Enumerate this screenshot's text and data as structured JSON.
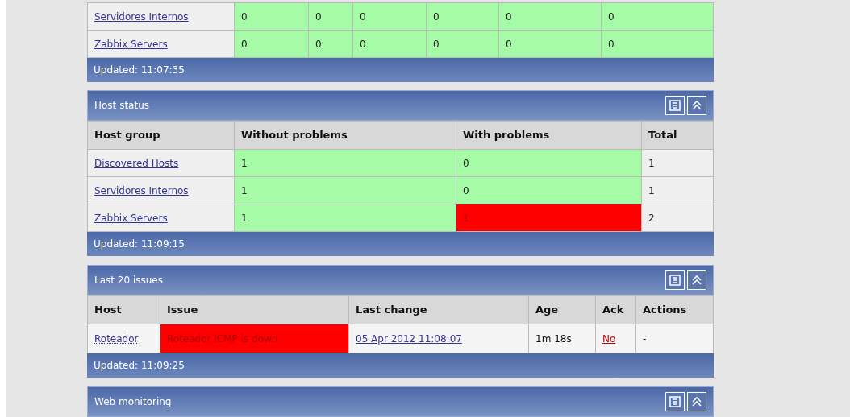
{
  "system_status": {
    "rows": [
      {
        "group": "Servidores Internos",
        "cells": [
          {
            "text": "0",
            "problem": false
          },
          {
            "text": "0",
            "problem": false
          },
          {
            "text": "0",
            "problem": false
          },
          {
            "text": "0",
            "problem": false
          },
          {
            "text": "0",
            "problem": false
          },
          {
            "text": "0",
            "problem": false
          }
        ]
      },
      {
        "group": "Zabbix Servers",
        "cells": [
          {
            "text": "0",
            "problem": false
          },
          {
            "text": "0",
            "problem": false
          },
          {
            "text": "0",
            "problem": false
          },
          {
            "text": "0",
            "problem": false
          },
          {
            "text": "0",
            "problem": false
          },
          {
            "text": "0",
            "problem": false
          }
        ]
      }
    ],
    "updated": "Updated: 11:07:35"
  },
  "host_status": {
    "title": "Host status",
    "columns": [
      "Host group",
      "Without problems",
      "With problems",
      "Total"
    ],
    "rows": [
      {
        "group": "Discovered Hosts",
        "without": {
          "text": "1",
          "problem": false
        },
        "with": {
          "text": "0",
          "problem": false
        },
        "total": "1"
      },
      {
        "group": "Servidores Internos",
        "without": {
          "text": "1",
          "problem": false
        },
        "with": {
          "text": "0",
          "problem": false
        },
        "total": "1"
      },
      {
        "group": "Zabbix Servers",
        "without": {
          "text": "1",
          "problem": false
        },
        "with": {
          "text": "1",
          "problem": true
        },
        "total": "2"
      }
    ],
    "updated": "Updated: 11:09:15"
  },
  "last_issues": {
    "title": "Last 20 issues",
    "columns": [
      "Host",
      "Issue",
      "Last change",
      "Age",
      "Ack",
      "Actions"
    ],
    "rows": [
      {
        "host": "Roteador",
        "issue": "Roteador ICMP is down",
        "problem": true,
        "last_change": "05 Apr 2012 11:08:07",
        "age": "1m 18s",
        "ack": "No",
        "actions": "-"
      }
    ],
    "updated": "Updated: 11:09:25"
  },
  "web_monitoring": {
    "title": "Web monitoring"
  }
}
